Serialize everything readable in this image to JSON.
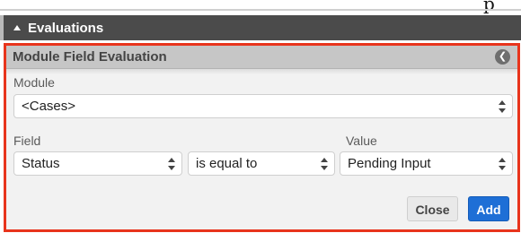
{
  "top_glyph": "p",
  "section": {
    "title": "Evaluations"
  },
  "panel": {
    "title": "Module Field Evaluation",
    "module_label": "Module",
    "module_value": "<Cases>",
    "field_label": "Field",
    "field_value": "Status",
    "operator_value": "is equal to",
    "value_label": "Value",
    "value_value": "Pending Input",
    "close_label": "Close",
    "add_label": "Add"
  },
  "colors": {
    "highlight_border": "#e8341c",
    "add_button": "#1e6fd6",
    "section_header": "#4b4b4b"
  },
  "icons": {
    "section_toggle": "caret-up-icon",
    "back": "circle-chevron-left-icon",
    "select_arrows": "up-down-arrows-icon"
  }
}
